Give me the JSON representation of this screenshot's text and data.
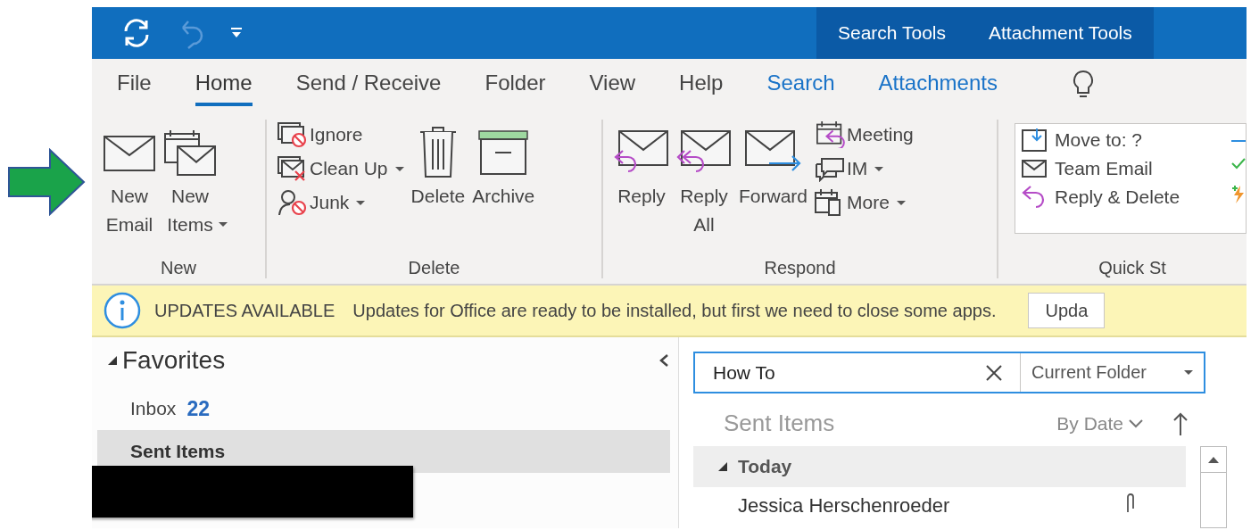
{
  "title_bar": {
    "context_tabs": [
      "Search Tools",
      "Attachment Tools"
    ]
  },
  "tabs": [
    {
      "label": "File",
      "selected": false,
      "kind": "normal"
    },
    {
      "label": "Home",
      "selected": true,
      "kind": "normal"
    },
    {
      "label": "Send / Receive",
      "selected": false,
      "kind": "normal"
    },
    {
      "label": "Folder",
      "selected": false,
      "kind": "normal"
    },
    {
      "label": "View",
      "selected": false,
      "kind": "normal"
    },
    {
      "label": "Help",
      "selected": false,
      "kind": "normal"
    },
    {
      "label": "Search",
      "selected": false,
      "kind": "contextual"
    },
    {
      "label": "Attachments",
      "selected": false,
      "kind": "contextual"
    }
  ],
  "ribbon": [
    {
      "label": "New",
      "commands": [
        {
          "label": "New Email",
          "kind": "large",
          "dropdown": false
        },
        {
          "label": "New Items",
          "kind": "large",
          "dropdown": true
        }
      ]
    },
    {
      "label": "Delete",
      "commands": [
        {
          "label": "Ignore",
          "kind": "small",
          "dropdown": false
        },
        {
          "label": "Clean Up",
          "kind": "small",
          "dropdown": true
        },
        {
          "label": "Junk",
          "kind": "small",
          "dropdown": true
        },
        {
          "label": "Delete",
          "kind": "large",
          "dropdown": false
        },
        {
          "label": "Archive",
          "kind": "large",
          "dropdown": false
        }
      ]
    },
    {
      "label": "Respond",
      "commands": [
        {
          "label": "Reply",
          "kind": "large",
          "dropdown": false
        },
        {
          "label": "Reply All",
          "kind": "large",
          "dropdown": false
        },
        {
          "label": "Forward",
          "kind": "large",
          "dropdown": false
        },
        {
          "label": "Meeting",
          "kind": "small",
          "dropdown": false
        },
        {
          "label": "IM",
          "kind": "small",
          "dropdown": true
        },
        {
          "label": "More",
          "kind": "small",
          "dropdown": true
        }
      ]
    },
    {
      "label": "Quick St",
      "commands": [
        {
          "label": "Move to: ?",
          "kind": "gallery"
        },
        {
          "label": "Team Email",
          "kind": "gallery"
        },
        {
          "label": "Reply & Delete",
          "kind": "gallery"
        }
      ]
    }
  ],
  "notification": {
    "title": "UPDATES AVAILABLE",
    "message": "Updates for Office are ready to be installed, but first we need to close some apps.",
    "button": "Upda"
  },
  "folders": {
    "header": "Favorites",
    "expanded": true,
    "items": [
      {
        "label": "Inbox",
        "count": "22",
        "selected": false
      },
      {
        "label": "Sent Items",
        "selected": true
      }
    ]
  },
  "search": {
    "value": "How To",
    "scope": "Current Folder"
  },
  "mail_list": {
    "folder": "Sent Items",
    "sort": "By Date",
    "groups": [
      {
        "label": "Today",
        "expanded": true,
        "items": [
          {
            "sender": "Jessica Herschenroeder",
            "attachment": true
          }
        ]
      }
    ]
  }
}
